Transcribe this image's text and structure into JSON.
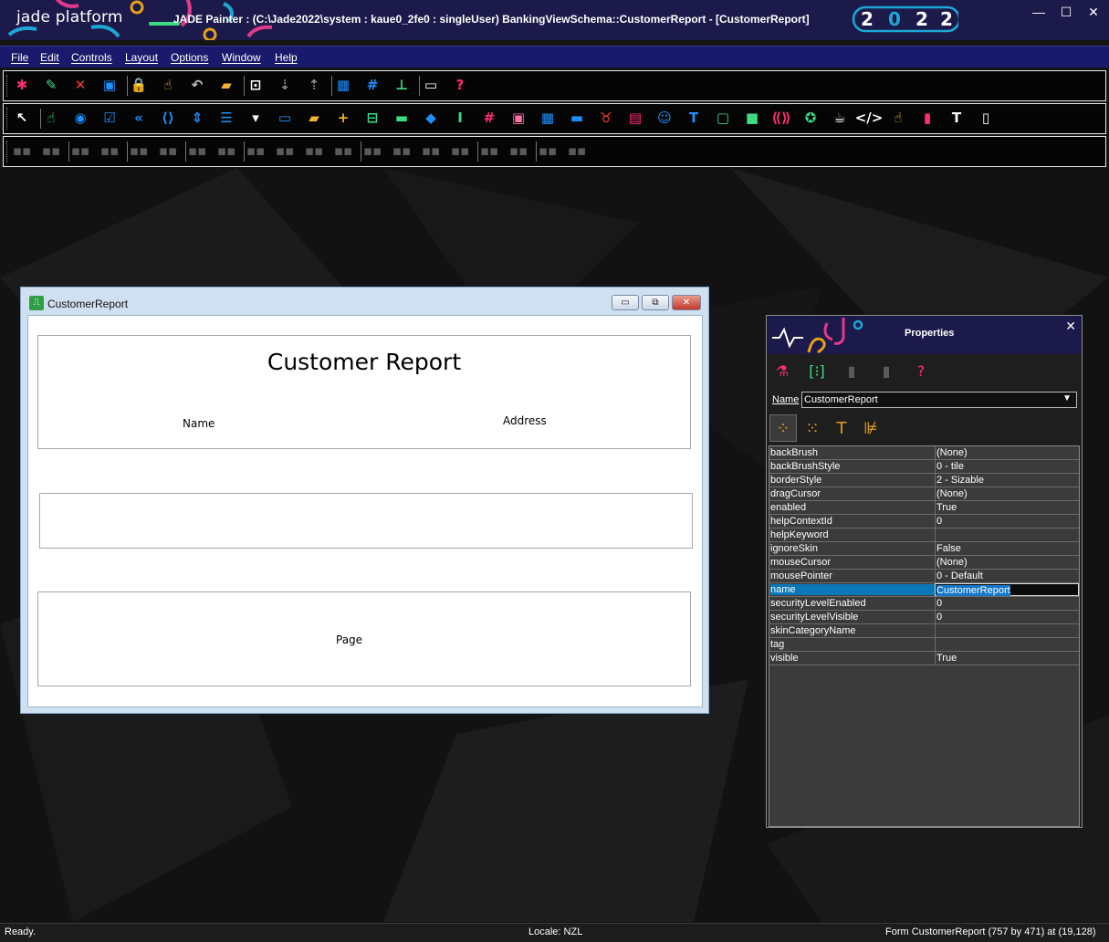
{
  "app": {
    "brand": "jade platform",
    "title": "JADE Painter : (C:\\Jade2022\\system : kaue0_2fe0 : singleUser) BankingViewSchema::CustomerReport - [CustomerReport]",
    "year_digits": [
      "2",
      "0",
      "2",
      "2"
    ],
    "window_controls": {
      "minimize": "—",
      "maximize": "☐",
      "close": "✕"
    }
  },
  "menu": [
    "File",
    "Edit",
    "Controls",
    "Layout",
    "Options",
    "Window",
    "Help"
  ],
  "toolbar1": [
    {
      "icon": "new-form-icon",
      "glyph": "✱",
      "color": "#ff2d6f"
    },
    {
      "icon": "edit-form-icon",
      "glyph": "✎",
      "color": "#3ddc84"
    },
    {
      "icon": "delete-form-icon",
      "glyph": "✕",
      "color": "#ff3b3b"
    },
    {
      "icon": "save-icon",
      "glyph": "▣",
      "color": "#1e90ff"
    },
    {
      "icon": "lock-icon",
      "glyph": "🔒",
      "color": "#f2b233"
    },
    {
      "icon": "select-pointer-icon",
      "glyph": "☝",
      "color": "#f2b233"
    },
    {
      "icon": "undo-icon",
      "glyph": "↶",
      "color": "#bfbfbf"
    },
    {
      "icon": "open-folder-icon",
      "glyph": "▰",
      "color": "#f2b233"
    },
    {
      "icon": "tab-order-icon",
      "glyph": "⊡",
      "color": "#ffffff"
    },
    {
      "icon": "send-back-icon",
      "glyph": "⇣",
      "color": "#8a8a8a"
    },
    {
      "icon": "bring-front-icon",
      "glyph": "⇡",
      "color": "#8a8a8a"
    },
    {
      "icon": "grid-icon",
      "glyph": "▦",
      "color": "#1e90ff"
    },
    {
      "icon": "snap-grid-icon",
      "glyph": "#",
      "color": "#1e90ff"
    },
    {
      "icon": "hierarchy-icon",
      "glyph": "⊥",
      "color": "#3ddc84"
    },
    {
      "icon": "comment-icon",
      "glyph": "▭",
      "color": "#ffffff"
    },
    {
      "icon": "help-icon",
      "glyph": "?",
      "color": "#ff2d6f"
    }
  ],
  "toolbar2": [
    {
      "icon": "arrow-pointer-icon",
      "glyph": "↖",
      "color": "#ffffff"
    },
    {
      "icon": "click-tool-icon",
      "glyph": "☝",
      "color": "#3ddc84"
    },
    {
      "icon": "option-button-icon",
      "glyph": "◉",
      "color": "#1e90ff"
    },
    {
      "icon": "checkbox-icon",
      "glyph": "☑",
      "color": "#1e90ff"
    },
    {
      "icon": "jump-start-icon",
      "glyph": "«",
      "color": "#1e90ff"
    },
    {
      "icon": "code-brackets-icon",
      "glyph": "⟨⟩",
      "color": "#1e90ff"
    },
    {
      "icon": "spin-icon",
      "glyph": "⇕",
      "color": "#1e90ff"
    },
    {
      "icon": "list-box-icon",
      "glyph": "☰",
      "color": "#1e90ff"
    },
    {
      "icon": "combo-box-icon",
      "glyph": "▾",
      "color": "#ffffff"
    },
    {
      "icon": "frame-icon",
      "glyph": "▭",
      "color": "#1e90ff"
    },
    {
      "icon": "folder-icon",
      "glyph": "▰",
      "color": "#f2b233"
    },
    {
      "icon": "add-folder-icon",
      "glyph": "+",
      "color": "#f2b233"
    },
    {
      "icon": "group-box-icon",
      "glyph": "⊟",
      "color": "#3ddc84"
    },
    {
      "icon": "status-line-icon",
      "glyph": "▬",
      "color": "#3ddc84"
    },
    {
      "icon": "tag-icon",
      "glyph": "◆",
      "color": "#1e90ff"
    },
    {
      "icon": "text-box-icon",
      "glyph": "I",
      "color": "#3ddc84"
    },
    {
      "icon": "hash-icon",
      "glyph": "#",
      "color": "#ff2d6f"
    },
    {
      "icon": "shopping-bag-icon",
      "glyph": "▣",
      "color": "#ff6fa8"
    },
    {
      "icon": "table-icon",
      "glyph": "▦",
      "color": "#1e90ff"
    },
    {
      "icon": "progress-bar-icon",
      "glyph": "▬",
      "color": "#1e90ff"
    },
    {
      "icon": "bull-icon",
      "glyph": "♉",
      "color": "#ff3b3b"
    },
    {
      "icon": "film-icon",
      "glyph": "▤",
      "color": "#ff2d6f"
    },
    {
      "icon": "mask-icon",
      "glyph": "☺",
      "color": "#1e90ff"
    },
    {
      "icon": "font-t-icon",
      "glyph": "T",
      "color": "#1e90ff"
    },
    {
      "icon": "sheet-icon",
      "glyph": "▢",
      "color": "#3ddc84"
    },
    {
      "icon": "panel-icon",
      "glyph": "■",
      "color": "#3ddc84"
    },
    {
      "icon": "ole-icon",
      "glyph": "⟪⟫",
      "color": "#ff2d6f"
    },
    {
      "icon": "starbucks-icon",
      "glyph": "✪",
      "color": "#3ddc84"
    },
    {
      "icon": "coffee-cup-icon",
      "glyph": "☕",
      "color": "#ffffff"
    },
    {
      "icon": "html-code-icon",
      "glyph": "</>",
      "color": "#ffffff"
    },
    {
      "icon": "selection-hand-icon",
      "glyph": "☝",
      "color": "#f2b233"
    },
    {
      "icon": "chart-icon",
      "glyph": "▮",
      "color": "#ff2d6f"
    },
    {
      "icon": "text-icon",
      "glyph": "T",
      "color": "#ffffff"
    },
    {
      "icon": "page-icon",
      "glyph": "▯",
      "color": "#ffffff"
    }
  ],
  "toolbar3": [
    "align-left-icon",
    "align-top-icon",
    "align-bottom-icon",
    "align-right-icon",
    "center-vertical-icon",
    "center-horizontal-icon",
    "same-width-icon",
    "same-height-icon",
    "same-size-icon",
    "size-to-grid-icon",
    "space-horizontal-icon",
    "space-vertical-icon",
    "increase-h-space-icon",
    "decrease-h-space-icon",
    "increase-v-space-icon",
    "decrease-v-space-icon",
    "equal-h-space-icon",
    "equal-v-space-icon",
    "distribute-icon",
    "stack-icon"
  ],
  "form": {
    "window_title": "CustomerReport",
    "buttons": {
      "minimize": "▭",
      "restore": "⧉",
      "close": "✕"
    },
    "report_title": "Customer Report",
    "header_labels": {
      "name": "Name",
      "address": "Address"
    },
    "footer_label": "Page"
  },
  "properties": {
    "title": "Properties",
    "close": "✕",
    "toolbar": [
      {
        "icon": "flask-icon",
        "glyph": "⚗",
        "color": "#ff2d6f"
      },
      {
        "icon": "brackets-tree-icon",
        "glyph": "[⁝]",
        "color": "#3ddc84"
      },
      {
        "icon": "bin-icon",
        "glyph": "▮",
        "color": "#5a5a5a"
      },
      {
        "icon": "clipboard-icon",
        "glyph": "▮",
        "color": "#5a5a5a"
      },
      {
        "icon": "help-icon",
        "glyph": "?",
        "color": "#ff2d6f"
      }
    ],
    "name_label": "Name",
    "name_value": "CustomerReport",
    "tabs": [
      {
        "icon": "all-properties-icon",
        "glyph": "⁘",
        "active": true
      },
      {
        "icon": "selected-properties-icon",
        "glyph": "⁙",
        "active": false
      },
      {
        "icon": "font-properties-icon",
        "glyph": "T",
        "active": false
      },
      {
        "icon": "layout-properties-icon",
        "glyph": "⊯",
        "active": false
      }
    ],
    "rows": [
      {
        "name": "backBrush",
        "value": "(None)"
      },
      {
        "name": "backBrushStyle",
        "value": "0 - tile"
      },
      {
        "name": "borderStyle",
        "value": "2 - Sizable"
      },
      {
        "name": "dragCursor",
        "value": "(None)"
      },
      {
        "name": "enabled",
        "value": "True"
      },
      {
        "name": "helpContextId",
        "value": "0"
      },
      {
        "name": "helpKeyword",
        "value": ""
      },
      {
        "name": "ignoreSkin",
        "value": "False"
      },
      {
        "name": "mouseCursor",
        "value": "(None)"
      },
      {
        "name": "mousePointer",
        "value": " 0 - Default"
      },
      {
        "name": "name",
        "value": "CustomerReport",
        "selected": true
      },
      {
        "name": "securityLevelEnabled",
        "value": "0"
      },
      {
        "name": "securityLevelVisible",
        "value": "0"
      },
      {
        "name": "skinCategoryName",
        "value": ""
      },
      {
        "name": "tag",
        "value": ""
      },
      {
        "name": "visible",
        "value": "True"
      }
    ]
  },
  "status": {
    "left": "Ready.",
    "locale": "Locale: NZL",
    "right": "Form CustomerReport (757 by 471) at (19,128)"
  }
}
